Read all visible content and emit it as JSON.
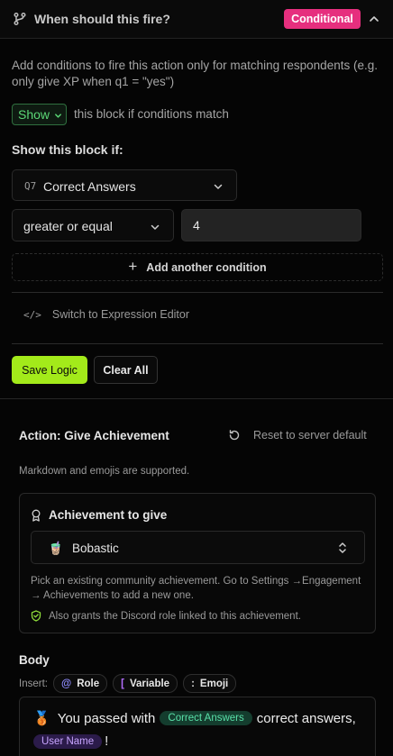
{
  "header": {
    "title": "When should this fire?",
    "badge": "Conditional",
    "badge_color": "#e62f7e"
  },
  "description": "Add conditions to fire this action only for matching respondents (e.g. only give XP when q1 = \"yes\")",
  "visibility": {
    "selected": "Show",
    "suffix": "this block if conditions match"
  },
  "conditions": {
    "label": "Show this block if:",
    "question_number": "Q7",
    "question": "Correct Answers",
    "operator": "greater or equal",
    "value": "4",
    "add_label": "Add another condition"
  },
  "expression_editor_label": "Switch to Expression Editor",
  "buttons": {
    "save": "Save Logic",
    "clear": "Clear All",
    "accent": "#a3ea1a"
  },
  "action": {
    "title": "Action: Give Achievement",
    "reset": "Reset to server default",
    "markdown_note": "Markdown and emojis are supported."
  },
  "achievement": {
    "title": "Achievement to give",
    "emoji": "🧋",
    "selected": "Bobastic",
    "help": "Pick an existing community achievement. Go to Settings →Engagement → Achievements to add a new one.",
    "also": "Also grants the Discord role linked to this achievement."
  },
  "body": {
    "label": "Body",
    "insert_label": "Insert:",
    "chips": {
      "role": "Role",
      "variable": "Variable",
      "emoji": "Emoji"
    },
    "editor": {
      "medal": "🥉",
      "text_before": "You passed with",
      "variable_pill": "Correct Answers",
      "text_after": "correct answers,",
      "user_pill": "User Name",
      "end": "!"
    }
  }
}
